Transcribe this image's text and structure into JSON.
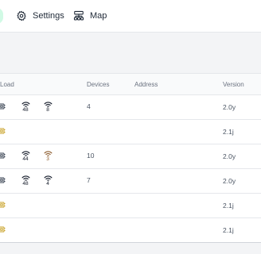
{
  "nav": {
    "settings_label": "Settings",
    "map_label": "Map"
  },
  "table": {
    "headers": {
      "load": "Load",
      "devices": "Devices",
      "address": "Address",
      "version": "Version"
    },
    "rows": [
      {
        "chip_color": "#374151",
        "wifi": [
          {
            "value": "48",
            "color": "#111827"
          },
          {
            "value": "8",
            "color": "#111827"
          }
        ],
        "devices": "4",
        "version": "2.0y"
      },
      {
        "chip_color": "#c9a227",
        "wifi": [],
        "devices": "",
        "version": "2.1j"
      },
      {
        "chip_color": "#374151",
        "wifi": [
          {
            "value": "44",
            "color": "#111827"
          },
          {
            "value": "3",
            "color": "#8b5a2b"
          }
        ],
        "devices": "10",
        "version": "2.0y"
      },
      {
        "chip_color": "#374151",
        "wifi": [
          {
            "value": "48",
            "color": "#111827"
          },
          {
            "value": "4",
            "color": "#111827"
          }
        ],
        "devices": "7",
        "version": "2.0y"
      },
      {
        "chip_color": "#c9a227",
        "wifi": [],
        "devices": "",
        "version": "2.1j"
      },
      {
        "chip_color": "#c9a227",
        "wifi": [],
        "devices": "",
        "version": "2.1j"
      }
    ]
  }
}
